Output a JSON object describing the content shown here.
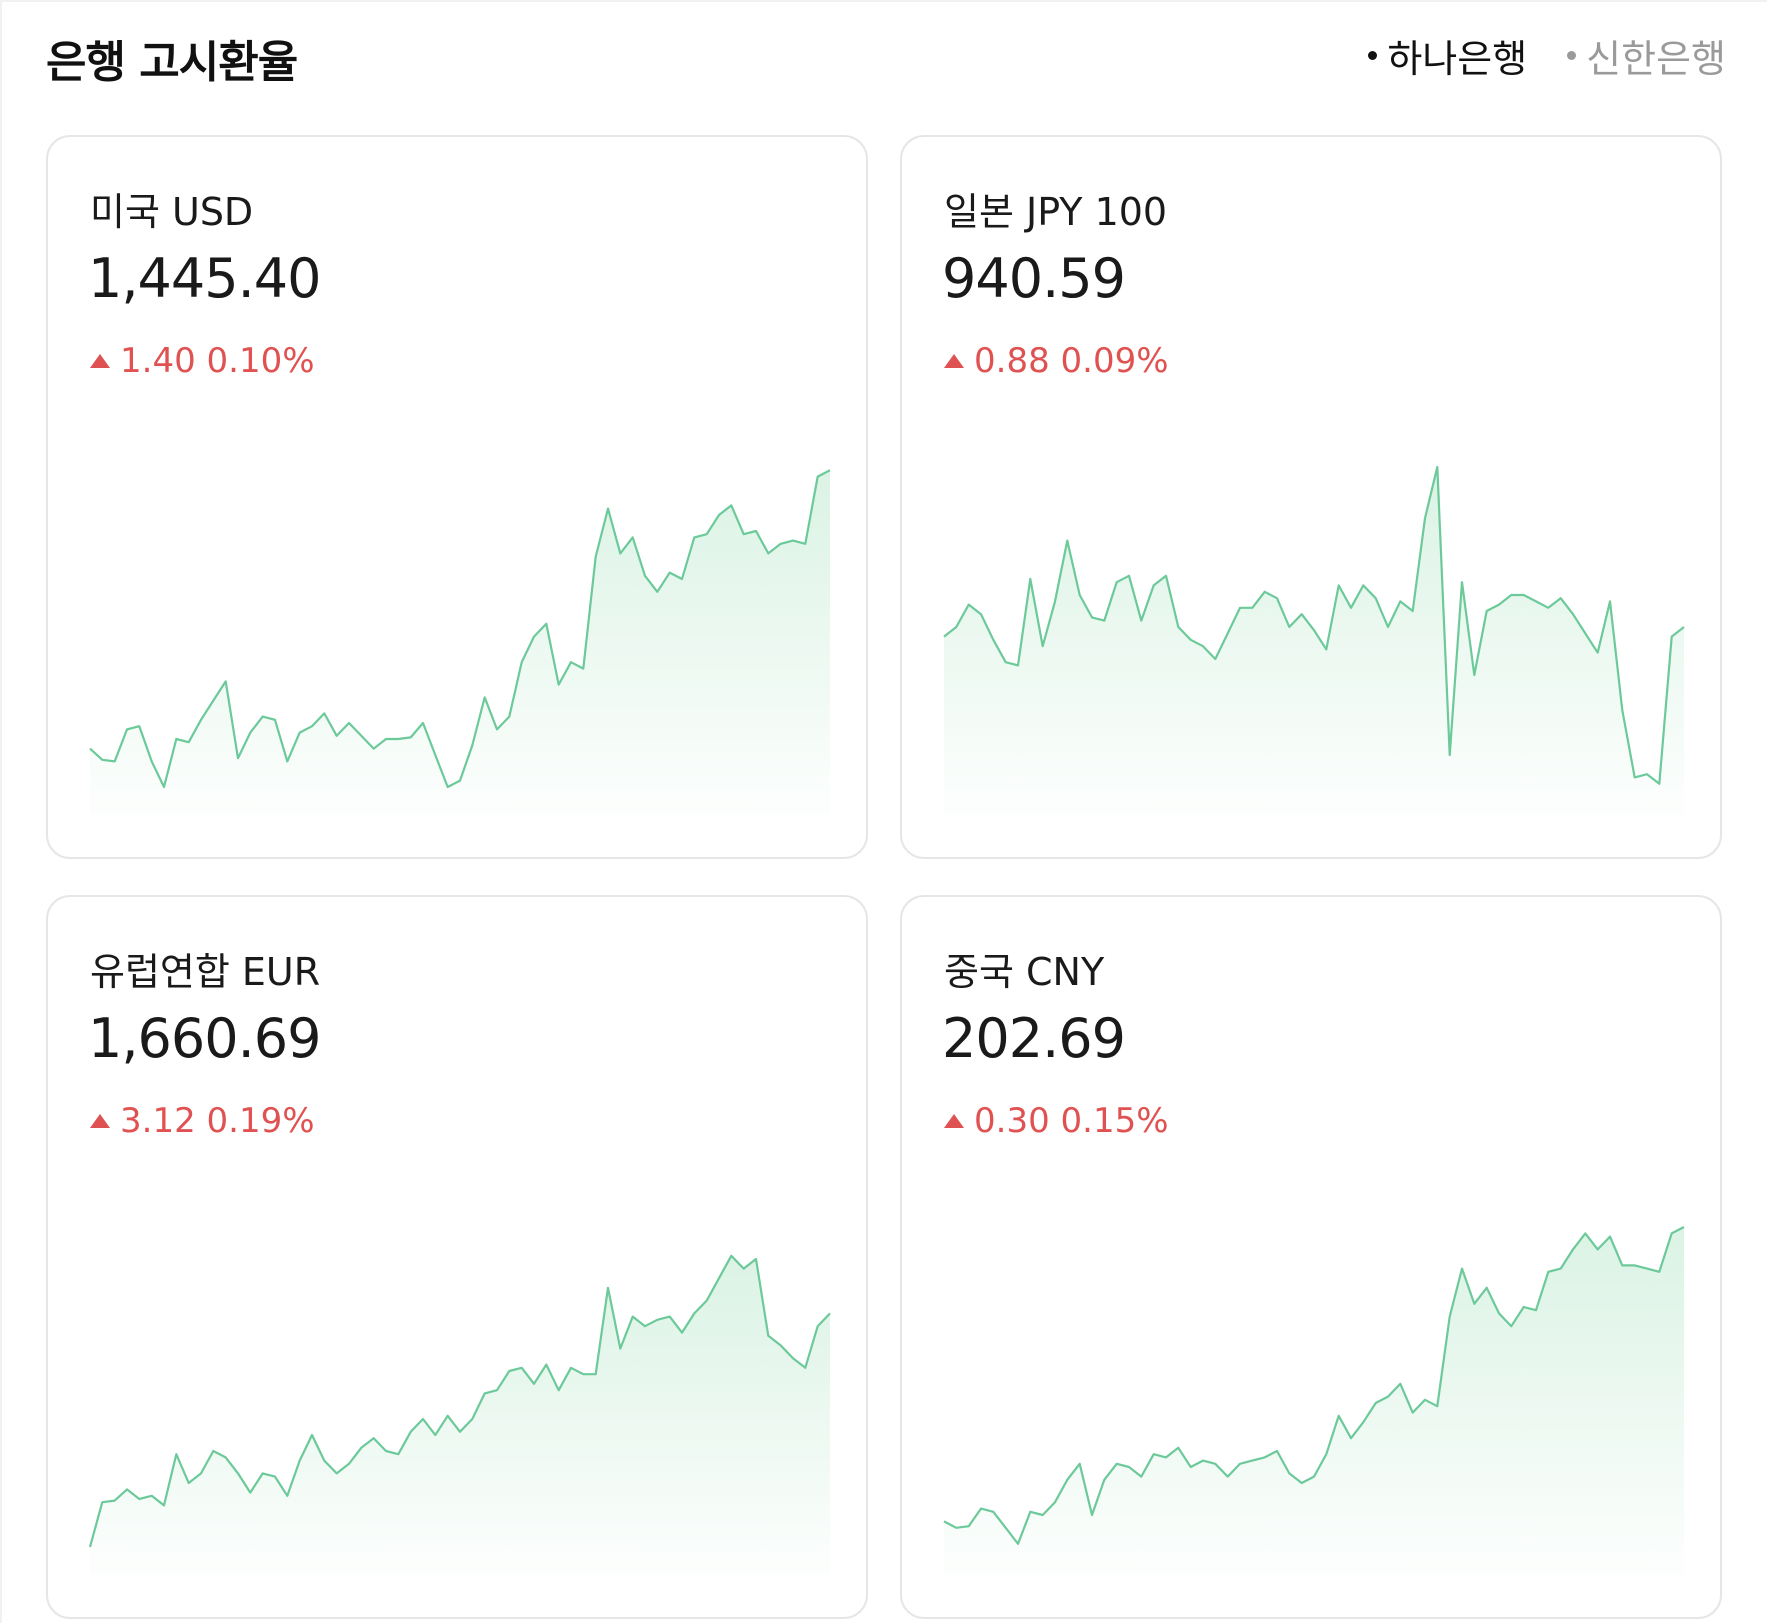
{
  "header": {
    "title": "은행 고시환율",
    "banks": [
      {
        "label": "하나은행",
        "active": true
      },
      {
        "label": "신한은행",
        "active": false
      }
    ]
  },
  "colors": {
    "up": "#e05252",
    "line": "#6cc99a",
    "fill": "#d9f2e3"
  },
  "cards": [
    {
      "name": "미국 USD",
      "rate": "1,445.40",
      "change": "1.40 0.10%",
      "direction": "up",
      "icon": "triangle-up-icon",
      "series": [
        0.12,
        0.085,
        0.08,
        0.18,
        0.19,
        0.08,
        0.0,
        0.15,
        0.14,
        0.21,
        0.27,
        0.33,
        0.09,
        0.17,
        0.22,
        0.21,
        0.08,
        0.17,
        0.19,
        0.23,
        0.16,
        0.2,
        0.16,
        0.12,
        0.15,
        0.15,
        0.155,
        0.2,
        0.1,
        0.0,
        0.02,
        0.13,
        0.28,
        0.18,
        0.22,
        0.39,
        0.47,
        0.51,
        0.32,
        0.39,
        0.37,
        0.72,
        0.87,
        0.73,
        0.78,
        0.66,
        0.61,
        0.67,
        0.65,
        0.78,
        0.79,
        0.85,
        0.88,
        0.79,
        0.8,
        0.73,
        0.76,
        0.77,
        0.76,
        0.97,
        0.99
      ]
    },
    {
      "name": "일본 JPY 100",
      "rate": "940.59",
      "change": "0.88 0.09%",
      "direction": "up",
      "icon": "triangle-up-icon",
      "series": [
        0.47,
        0.5,
        0.57,
        0.54,
        0.46,
        0.39,
        0.38,
        0.65,
        0.44,
        0.58,
        0.77,
        0.6,
        0.53,
        0.52,
        0.64,
        0.66,
        0.52,
        0.63,
        0.66,
        0.5,
        0.46,
        0.44,
        0.4,
        0.48,
        0.56,
        0.56,
        0.61,
        0.59,
        0.5,
        0.54,
        0.49,
        0.43,
        0.63,
        0.56,
        0.63,
        0.59,
        0.5,
        0.58,
        0.55,
        0.84,
        1.0,
        0.1,
        0.64,
        0.35,
        0.55,
        0.57,
        0.6,
        0.6,
        0.58,
        0.56,
        0.59,
        0.54,
        0.48,
        0.42,
        0.58,
        0.24,
        0.03,
        0.04,
        0.01,
        0.47,
        0.5
      ]
    },
    {
      "name": "유럽연합 EUR",
      "rate": "1,660.69",
      "change": "3.12 0.19%",
      "direction": "up",
      "icon": "triangle-up-icon",
      "series": [
        0.0,
        0.14,
        0.145,
        0.18,
        0.15,
        0.16,
        0.13,
        0.29,
        0.2,
        0.23,
        0.3,
        0.28,
        0.23,
        0.17,
        0.23,
        0.22,
        0.16,
        0.27,
        0.35,
        0.27,
        0.23,
        0.26,
        0.31,
        0.34,
        0.3,
        0.29,
        0.36,
        0.4,
        0.35,
        0.41,
        0.36,
        0.4,
        0.48,
        0.49,
        0.55,
        0.56,
        0.51,
        0.57,
        0.49,
        0.56,
        0.54,
        0.54,
        0.81,
        0.62,
        0.72,
        0.69,
        0.71,
        0.72,
        0.67,
        0.73,
        0.77,
        0.84,
        0.91,
        0.87,
        0.9,
        0.66,
        0.63,
        0.59,
        0.56,
        0.69,
        0.73
      ]
    },
    {
      "name": "중국 CNY",
      "rate": "202.69",
      "change": "0.30 0.15%",
      "direction": "up",
      "icon": "triangle-up-icon",
      "series": [
        0.08,
        0.06,
        0.065,
        0.12,
        0.11,
        0.06,
        0.01,
        0.11,
        0.1,
        0.14,
        0.21,
        0.26,
        0.1,
        0.21,
        0.26,
        0.25,
        0.22,
        0.29,
        0.28,
        0.31,
        0.25,
        0.27,
        0.26,
        0.22,
        0.26,
        0.27,
        0.28,
        0.3,
        0.23,
        0.2,
        0.22,
        0.29,
        0.41,
        0.34,
        0.39,
        0.45,
        0.47,
        0.51,
        0.42,
        0.46,
        0.44,
        0.72,
        0.87,
        0.76,
        0.81,
        0.73,
        0.69,
        0.75,
        0.74,
        0.86,
        0.87,
        0.93,
        0.98,
        0.93,
        0.97,
        0.88,
        0.88,
        0.87,
        0.86,
        0.98,
        1.0
      ]
    }
  ]
}
